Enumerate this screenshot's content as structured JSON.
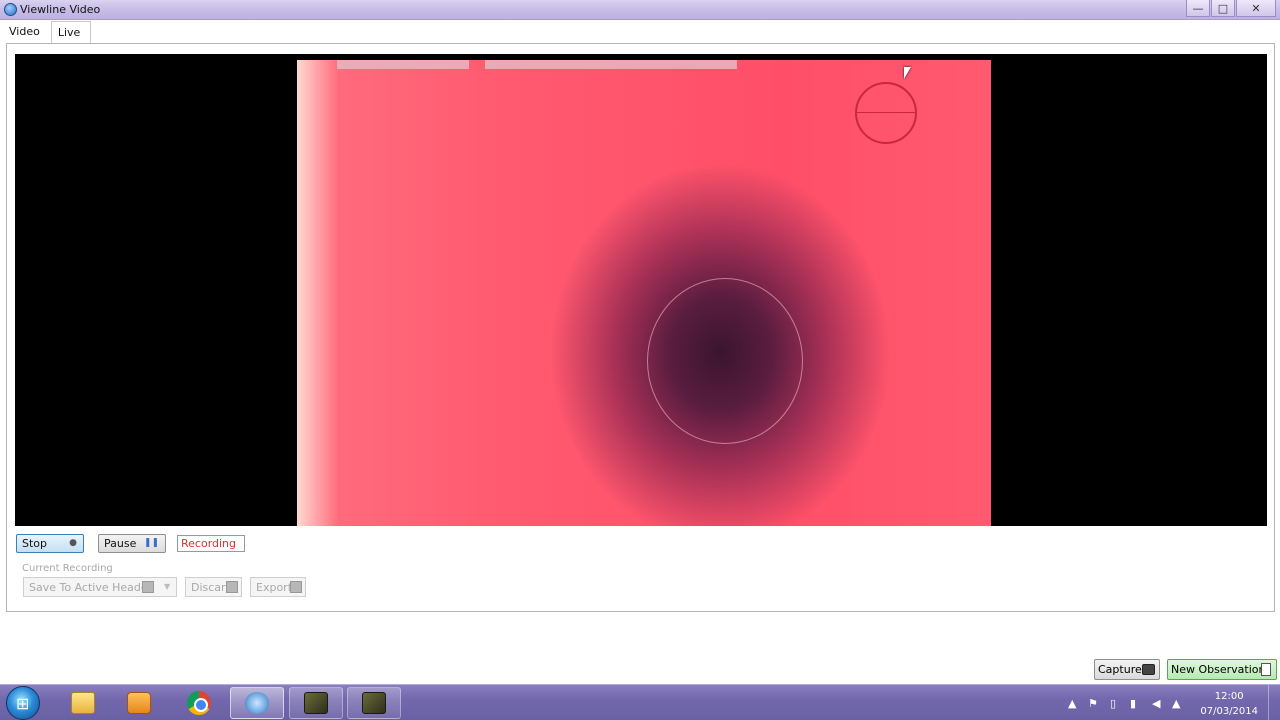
{
  "window": {
    "title": "Viewline Video",
    "controls": {
      "minimize": "—",
      "maximize": "□",
      "close": "✕"
    }
  },
  "tabs": [
    {
      "label": "Video",
      "active": false
    },
    {
      "label": "Live",
      "active": true
    }
  ],
  "video": {
    "overlay_color": "#c8283c"
  },
  "controls": {
    "stop_label": "Stop",
    "pause_label": "Pause",
    "recording_status": "Recording",
    "recording_color": "#e03030"
  },
  "current_recording": {
    "group_label": "Current Recording",
    "save_label": "Save To Active Header",
    "discard_label": "Discard",
    "export_label": "Export"
  },
  "footer": {
    "capture_label": "Capture",
    "new_observation_label": "New Observation",
    "new_observation_color": "#b6eab1"
  },
  "taskbar": {
    "pinned": [
      {
        "name": "windows-explorer-icon"
      },
      {
        "name": "media-player-icon"
      },
      {
        "name": "chrome-icon"
      },
      {
        "name": "settings-app-icon",
        "state": "active"
      },
      {
        "name": "viewline-app-icon",
        "state": "open"
      },
      {
        "name": "viewline-app-icon-2",
        "state": "open"
      }
    ],
    "clock": {
      "time": "12:00",
      "date": "07/03/2014"
    }
  }
}
